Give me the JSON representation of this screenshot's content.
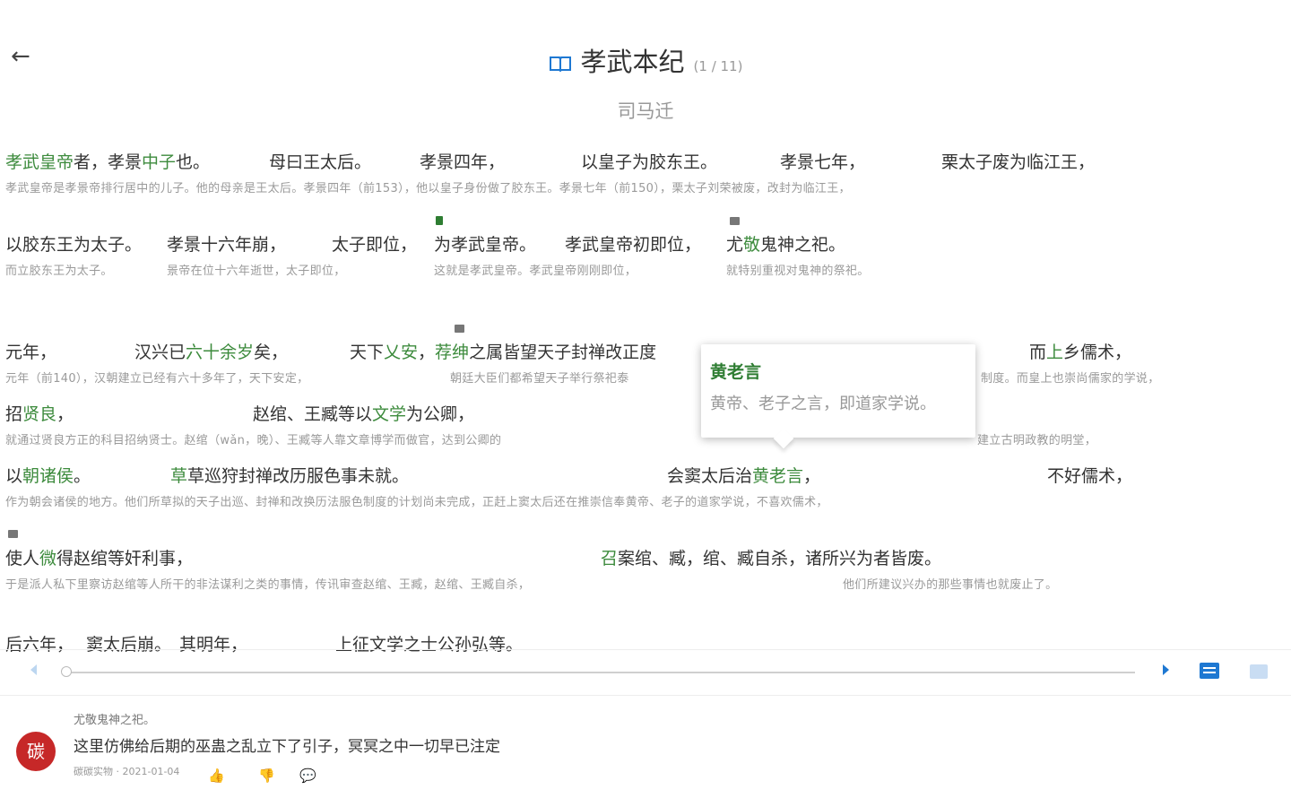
{
  "header": {
    "title": "孝武本纪",
    "pages": "(1 / 11)",
    "author": "司马迁"
  },
  "icons": {
    "back": "arrow-left-icon",
    "book": "open-book-icon"
  },
  "colors": {
    "highlight": "#3d8b3d",
    "accent": "#1e78d2",
    "avatar": "#c62828"
  },
  "p1": {
    "o1": "孝武皇帝",
    "o2": "者，孝景",
    "o3": "中子",
    "o4": "也。",
    "o5": "母曰王太后。",
    "o6": "孝景四年，",
    "o7": "以皇子为胶东王。",
    "o8": "孝景七年，",
    "o9": "栗太子废为临江王，",
    "t1": "孝武皇帝是孝景帝排行居中的儿子。他的母亲是王太后。孝景四年（前153），他以皇子身份做了胶东王。孝景七年（前150），栗太子刘荣被废，改封为临江王，"
  },
  "p2": {
    "o1": "以胶东王为太子。",
    "o2": "孝景十六年崩，",
    "o3": "太子即位，",
    "o4": "为孝武皇帝。",
    "o5": "孝武皇帝初即位，",
    "o6": "尤",
    "o7": "敬",
    "o8": "鬼神之祀。",
    "t1": "而立胶东王为太子。",
    "t2": "景帝在位十六年逝世，太子即位，",
    "t3": "这就是孝武皇帝。孝武皇帝刚刚即位，",
    "t4": "就特别重视对鬼神的祭祀。"
  },
  "p3": {
    "o1": "元年，",
    "o2": "汉兴已",
    "o3": "六十余岁",
    "o4": "矣，",
    "o5": "天下",
    "o6": "乂安",
    "o7": "，",
    "o8": "荐绅",
    "o9": "之属皆望天子封禅改正度",
    "o10": "而",
    "o11": "上",
    "o12": "乡儒术，",
    "t1": "元年（前140），汉朝建立已经有六十多年了，天下安定，",
    "t2": "朝廷大臣们都希望天子举行祭祀泰",
    "t3": "制度。而皇上也崇尚儒家的学说，"
  },
  "p4": {
    "o1": "招",
    "o2": "贤良",
    "o3": "，",
    "o4": "赵绾、王臧等以",
    "o5": "文学",
    "o6": "为公卿，",
    "t1": "就通过贤良方正的科目招纳贤士。赵绾（wǎn，晚）、王臧等人靠文章博学而做官，达到公卿的",
    "t2": "建立古明政教的明堂，"
  },
  "p5": {
    "o1": "以",
    "o2": "朝诸侯",
    "o3": "。",
    "o4": "草巡狩封禅改历服色事未就。",
    "o5": "会窦太后治",
    "o6": "黄老言",
    "o7": "，",
    "o8": "不好儒术，",
    "t1": "作为朝会诸侯的地方。他们所草拟的天子出巡、封禅和改换历法服色制度的计划尚未完成，正赶上窦太后还在推崇信奉黄帝、老子的道家学说，不喜欢儒术，"
  },
  "p6": {
    "o1": "使人",
    "o2": "微",
    "o3": "得赵绾等奸利事，",
    "o4": "召",
    "o5": "案绾、臧，绾、臧自杀，",
    "o6": "诸所兴为者皆废。",
    "t1": "于是派人私下里察访赵绾等人所干的非法谋利之类的事情，传讯审查赵绾、王臧，赵绾、王臧自杀，",
    "t2": "他们所建议兴办的那些事情也就废止了。"
  },
  "p7": {
    "o1": "后六年，",
    "o2": "窦太后崩。",
    "o3": "其明年，",
    "o4": "上征文学之士公孙弘等。"
  },
  "popup": {
    "term": "黄老言",
    "definition": "黄帝、老子之言，即道家学说。"
  },
  "progress": {
    "value": 0
  },
  "comment": {
    "quote": "尤敬鬼神之祀。",
    "avatar_char": "碳",
    "text": "这里仿佛给后期的巫蛊之乱立下了引子，冥冥之中一切早已注定",
    "meta": "碳碳实物 · 2021-01-04"
  }
}
